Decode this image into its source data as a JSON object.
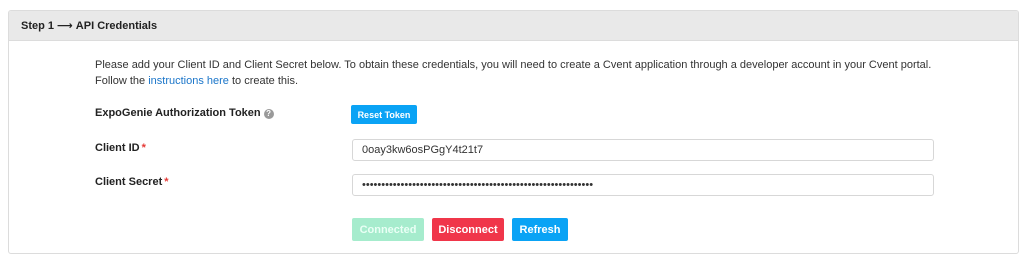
{
  "header": {
    "step_label": "Step 1",
    "arrow": "⟶",
    "title": "API Credentials"
  },
  "intro": {
    "text_before_link": "Please add your Client ID and Client Secret below. To obtain these credentials, you will need to create a Cvent application through a developer account in your Cvent portal. Follow the ",
    "link_text": "instructions here",
    "text_after_link": " to create this."
  },
  "auth_token": {
    "label": "ExpoGenie Authorization Token",
    "help_icon": "question-circle-icon",
    "reset_button": "Reset Token"
  },
  "client_id": {
    "label": "Client ID",
    "required_marker": "*",
    "value": "0oay3kw6osPGgY4t21t7"
  },
  "client_secret": {
    "label": "Client Secret",
    "required_marker": "*",
    "value": "••••••••••••••••••••••••••••••••••••••••••••••••••••••••••••"
  },
  "actions": {
    "connected": "Connected",
    "disconnect": "Disconnect",
    "refresh": "Refresh"
  },
  "colors": {
    "primary": "#0aa3f5",
    "danger": "#f0364a",
    "success_disabled": "#a6eccd",
    "link": "#1a75c9",
    "header_bg": "#e9e9e9"
  }
}
